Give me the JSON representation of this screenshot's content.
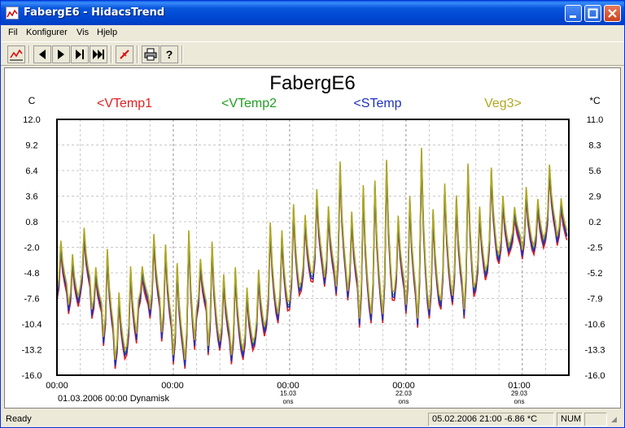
{
  "window": {
    "title": "FabergE6 - HidacsTrend"
  },
  "menu": {
    "items": [
      {
        "label": "Fil"
      },
      {
        "label": "Konfigurer"
      },
      {
        "label": "Vis"
      },
      {
        "label": "Hjelp"
      }
    ]
  },
  "toolbar": {
    "buttons": [
      "trend-graph-icon",
      "first-icon",
      "play-icon",
      "step-end-icon",
      "last-icon",
      "cursor-icon",
      "print-icon",
      "help-icon"
    ]
  },
  "status": {
    "ready": "Ready",
    "cursor_readout": "05.02.2006 21:00  -6.86 *C",
    "num": "NUM"
  },
  "chart_data": {
    "type": "line",
    "title": "FabergE6",
    "left_unit": "C",
    "right_unit": "*C",
    "left_ticks": [
      "12.0",
      "9.2",
      "6.4",
      "3.6",
      "0.8",
      "-2.0",
      "-4.8",
      "-7.6",
      "-10.4",
      "-13.2",
      "-16.0"
    ],
    "right_ticks": [
      "11.0",
      "8.3",
      "5.6",
      "2.9",
      "0.2",
      "-2.5",
      "-5.2",
      "-7.9",
      "-10.6",
      "-13.3",
      "-16.0"
    ],
    "ylim": [
      -16.0,
      12.0
    ],
    "x_ticks": [
      {
        "time": "00:00",
        "date": "",
        "day": ""
      },
      {
        "time": "00:00",
        "date": "",
        "day": ""
      },
      {
        "time": "00:00",
        "date": "15.03",
        "day": "ons"
      },
      {
        "time": "00:00",
        "date": "22.03",
        "day": "ons"
      },
      {
        "time": "01:00",
        "date": "29.03",
        "day": "ons"
      }
    ],
    "x_subtitle": "01.03.2006 00:00 Dynamisk",
    "grid": true,
    "days": 44,
    "day_max": [
      -1.0,
      -2.5,
      0.5,
      -4.0,
      -1.5,
      -6.5,
      -3.5,
      -4.0,
      0.0,
      -1.0,
      -3.0,
      1.0,
      -3.0,
      -0.5,
      -4.5,
      -3.5,
      -6.0,
      -4.0,
      1.5,
      0.5,
      3.5,
      2.0,
      5.0,
      3.0,
      8.5,
      2.5,
      6.0,
      6.5,
      9.0,
      2.0,
      4.5,
      10.5,
      3.0,
      6.0,
      4.5,
      8.5,
      3.0,
      7.5,
      4.0,
      2.5,
      5.0,
      3.5,
      7.5,
      3.5
    ],
    "day_min": [
      -7.0,
      -8.5,
      -6.5,
      -9.0,
      -12.0,
      -14.5,
      -13.0,
      -8.0,
      -9.0,
      -11.5,
      -14.0,
      -14.5,
      -9.0,
      -13.0,
      -12.5,
      -14.0,
      -13.5,
      -12.0,
      -10.0,
      -9.5,
      -8.0,
      -6.0,
      -5.0,
      -5.5,
      -6.5,
      -7.0,
      -10.0,
      -9.5,
      -9.5,
      -7.0,
      -8.5,
      -10.0,
      -9.0,
      -8.0,
      -7.5,
      -9.0,
      -6.0,
      -4.0,
      -3.0,
      -1.5,
      -2.5,
      -2.0,
      -0.5,
      -1.0
    ],
    "series": [
      {
        "name": "<VTemp1",
        "color": "#e02020",
        "offset_low": -0.8,
        "offset_high": -1.0
      },
      {
        "name": "<VTemp2",
        "color": "#20a020",
        "offset_low": -0.2,
        "offset_high": -0.5
      },
      {
        "name": "<STemp",
        "color": "#2030c0",
        "offset_low": -0.5,
        "offset_high": 0.0
      },
      {
        "name": "Veg3>",
        "color": "#b0a820",
        "offset_low": 0.2,
        "offset_high": 0.3
      }
    ]
  }
}
